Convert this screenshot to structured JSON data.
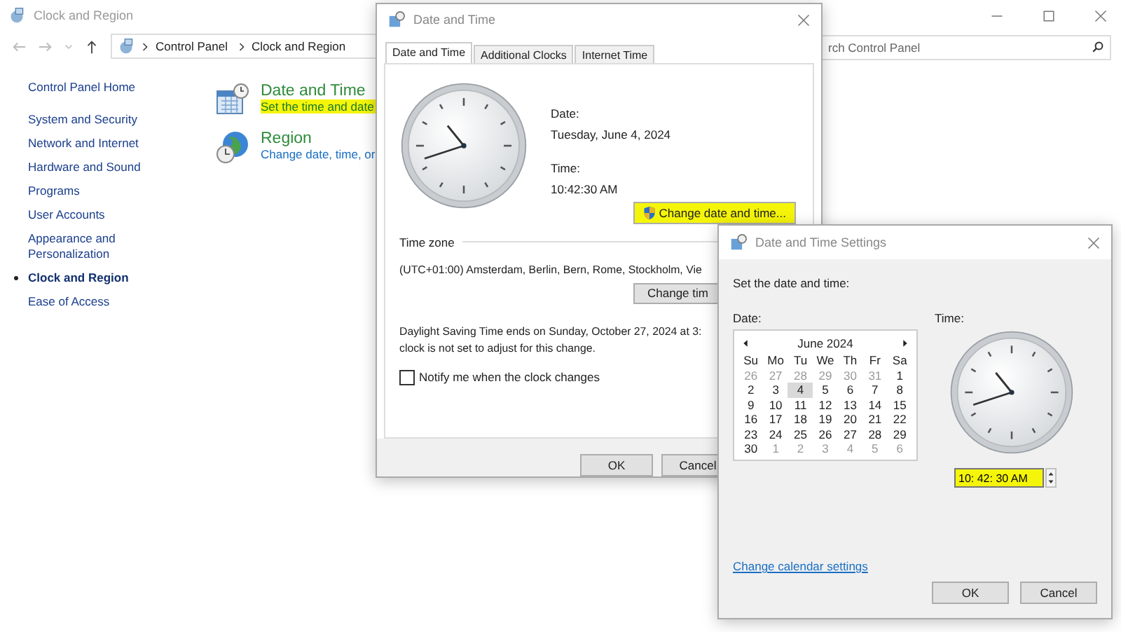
{
  "control_panel": {
    "title": "Clock and Region",
    "breadcrumb": [
      "Control Panel",
      "Clock and Region"
    ],
    "search": {
      "placeholder": "rch Control Panel"
    },
    "sidebar": {
      "home": "Control Panel Home",
      "items": [
        {
          "label": "System and Security",
          "selected": false
        },
        {
          "label": "Network and Internet",
          "selected": false
        },
        {
          "label": "Hardware and Sound",
          "selected": false
        },
        {
          "label": "Programs",
          "selected": false
        },
        {
          "label": "User Accounts",
          "selected": false
        },
        {
          "label": "Appearance and Personalization",
          "selected": false
        },
        {
          "label": "Clock and Region",
          "selected": true
        },
        {
          "label": "Ease of Access",
          "selected": false
        }
      ]
    },
    "categories": [
      {
        "title": "Date and Time",
        "link": {
          "text": "Set the time and date",
          "highlighted": true
        }
      },
      {
        "title": "Region",
        "link": {
          "text": "Change date, time, or",
          "highlighted": false
        }
      }
    ]
  },
  "date_time_dialog": {
    "title": "Date and Time",
    "tabs": [
      {
        "label": "Date and Time",
        "selected": true
      },
      {
        "label": "Additional Clocks",
        "selected": false
      },
      {
        "label": "Internet Time",
        "selected": false
      }
    ],
    "date_label": "Date:",
    "date": "Tuesday, June 4, 2024",
    "time_label": "Time:",
    "time": "10:42:30 AM",
    "change_button": {
      "label": "Change date and time...",
      "highlighted": true
    },
    "time_zone_heading": "Time zone",
    "time_zone": "(UTC+01:00) Amsterdam, Berlin, Bern, Rome, Stockholm, Vie",
    "change_zone_button": "Change tim",
    "dst_notice": [
      "Daylight Saving Time ends on Sunday, October 27, 2024 at 3:",
      "clock is not set to adjust for this change."
    ],
    "notify": {
      "label": "Notify me when the clock changes",
      "checked": false
    },
    "buttons": [
      "OK",
      "Cancel"
    ]
  },
  "settings_dialog": {
    "title": "Date and Time Settings",
    "instruction": "Set the date and time:",
    "date_label": "Date:",
    "time_label": "Time:",
    "calendar": {
      "month": "June 2024",
      "weekdays": [
        "Su",
        "Mo",
        "Tu",
        "We",
        "Th",
        "Fr",
        "Sa"
      ],
      "days": [
        {
          "d": "26",
          "other_month": true,
          "selected": false
        },
        {
          "d": "27",
          "other_month": true,
          "selected": false
        },
        {
          "d": "28",
          "other_month": true,
          "selected": false
        },
        {
          "d": "29",
          "other_month": true,
          "selected": false
        },
        {
          "d": "30",
          "other_month": true,
          "selected": false
        },
        {
          "d": "31",
          "other_month": true,
          "selected": false
        },
        {
          "d": "1",
          "other_month": false,
          "selected": false
        },
        {
          "d": "2",
          "other_month": false,
          "selected": false
        },
        {
          "d": "3",
          "other_month": false,
          "selected": false
        },
        {
          "d": "4",
          "other_month": false,
          "selected": true
        },
        {
          "d": "5",
          "other_month": false,
          "selected": false
        },
        {
          "d": "6",
          "other_month": false,
          "selected": false
        },
        {
          "d": "7",
          "other_month": false,
          "selected": false
        },
        {
          "d": "8",
          "other_month": false,
          "selected": false
        },
        {
          "d": "9",
          "other_month": false,
          "selected": false
        },
        {
          "d": "10",
          "other_month": false,
          "selected": false
        },
        {
          "d": "11",
          "other_month": false,
          "selected": false
        },
        {
          "d": "12",
          "other_month": false,
          "selected": false
        },
        {
          "d": "13",
          "other_month": false,
          "selected": false
        },
        {
          "d": "14",
          "other_month": false,
          "selected": false
        },
        {
          "d": "15",
          "other_month": false,
          "selected": false
        },
        {
          "d": "16",
          "other_month": false,
          "selected": false
        },
        {
          "d": "17",
          "other_month": false,
          "selected": false
        },
        {
          "d": "18",
          "other_month": false,
          "selected": false
        },
        {
          "d": "19",
          "other_month": false,
          "selected": false
        },
        {
          "d": "20",
          "other_month": false,
          "selected": false
        },
        {
          "d": "21",
          "other_month": false,
          "selected": false
        },
        {
          "d": "22",
          "other_month": false,
          "selected": false
        },
        {
          "d": "23",
          "other_month": false,
          "selected": false
        },
        {
          "d": "24",
          "other_month": false,
          "selected": false
        },
        {
          "d": "25",
          "other_month": false,
          "selected": false
        },
        {
          "d": "26",
          "other_month": false,
          "selected": false
        },
        {
          "d": "27",
          "other_month": false,
          "selected": false
        },
        {
          "d": "28",
          "other_month": false,
          "selected": false
        },
        {
          "d": "29",
          "other_month": false,
          "selected": false
        },
        {
          "d": "30",
          "other_month": false,
          "selected": false
        },
        {
          "d": "1",
          "other_month": true,
          "selected": false
        },
        {
          "d": "2",
          "other_month": true,
          "selected": false
        },
        {
          "d": "3",
          "other_month": true,
          "selected": false
        },
        {
          "d": "4",
          "other_month": true,
          "selected": false
        },
        {
          "d": "5",
          "other_month": true,
          "selected": false
        },
        {
          "d": "6",
          "other_month": true,
          "selected": false
        }
      ]
    },
    "time_field": {
      "value": "10: 42: 30 AM",
      "highlighted": true
    },
    "link": "Change calendar settings",
    "buttons": [
      "OK",
      "Cancel"
    ]
  }
}
